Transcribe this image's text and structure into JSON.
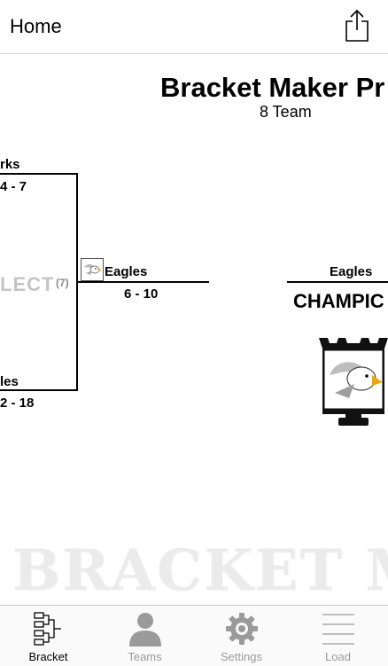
{
  "nav": {
    "title": "Home"
  },
  "header": {
    "title": "Bracket Maker Pr",
    "subtitle": "8 Team"
  },
  "bracket": {
    "top_team": {
      "name": "rks",
      "score": "4 - 7"
    },
    "bottom_team": {
      "name": "les",
      "score": "2 - 18"
    },
    "select_label": "LECT",
    "select_seed": "(7)",
    "winner": {
      "name": "Eagles",
      "score": "6 - 10",
      "icon": "eagle-icon"
    },
    "champion": {
      "name": "Eagles",
      "label": "CHAMPIC",
      "icon": "trophy-icon"
    }
  },
  "watermark": "BRACKET MAKE",
  "tabbar": {
    "items": [
      {
        "label": "Bracket",
        "icon": "bracket-icon",
        "active": true
      },
      {
        "label": "Teams",
        "icon": "person-icon",
        "active": false
      },
      {
        "label": "Settings",
        "icon": "gear-icon",
        "active": false
      },
      {
        "label": "Load",
        "icon": "list-icon",
        "active": false
      }
    ]
  },
  "colors": {
    "watermark": "#ebebeb",
    "inactive_tab": "#9a9a9a",
    "select_text": "#c4c4c4"
  }
}
